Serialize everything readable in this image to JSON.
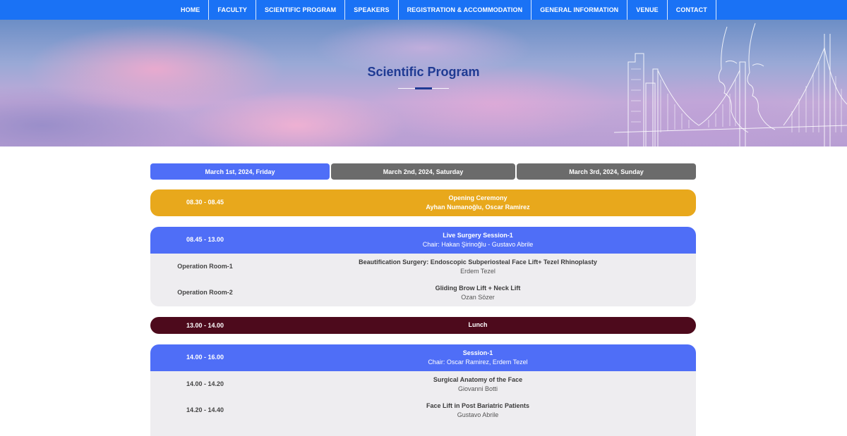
{
  "nav": {
    "items": [
      "HOME",
      "FACULTY",
      "SCIENTIFIC PROGRAM",
      "SPEAKERS",
      "REGISTRATION & ACCOMMODATION",
      "GENERAL INFORMATION",
      "VENUE",
      "CONTACT"
    ]
  },
  "hero": {
    "title": "Scientific Program"
  },
  "tabs": [
    {
      "label": "March 1st, 2024, Friday",
      "active": true
    },
    {
      "label": "March 2nd, 2024, Saturday",
      "active": false
    },
    {
      "label": "March 3rd, 2024, Sunday",
      "active": false
    }
  ],
  "program": {
    "opening": {
      "time": "08.30 - 08.45",
      "title": "Opening Ceremony",
      "speakers": "Ayhan Numanoğlu, Oscar Ramirez",
      "color": "#e8a81c"
    },
    "live_surgery": {
      "time": "08.45 - 13.00",
      "title": "Live Surgery Session-1",
      "chair": "Chair: Hakan Şirinoğlu - Gustavo Abrile",
      "rows": [
        {
          "time": "Operation Room-1",
          "title": "Beautification Surgery: Endoscopic Subperiosteal Face Lift+ Tezel Rhinoplasty",
          "speaker": "Erdem Tezel"
        },
        {
          "time": "Operation Room-2",
          "title": "Gliding Brow Lift + Neck Lift",
          "speaker": "Ozan Sözer"
        }
      ]
    },
    "lunch": {
      "time": "13.00 - 14.00",
      "title": "Lunch",
      "color": "#4d0a1c"
    },
    "session1": {
      "time": "14.00 - 16.00",
      "title": "Session-1",
      "chair": "Chair: Oscar Ramirez, Erdem Tezel",
      "rows": [
        {
          "time": "14.00 - 14.20",
          "title": "Surgical Anatomy of the Face",
          "speaker": "Giovanni Botti"
        },
        {
          "time": "14.20 - 14.40",
          "title": "Face Lift in Post Bariatric Patients",
          "speaker": "Gustavo Abrile"
        }
      ]
    }
  },
  "colors": {
    "nav": "#1a72f5",
    "accent_blue": "#4f6ef7",
    "inactive_tab": "#6b6b6b",
    "title_blue": "#1f3a93"
  }
}
